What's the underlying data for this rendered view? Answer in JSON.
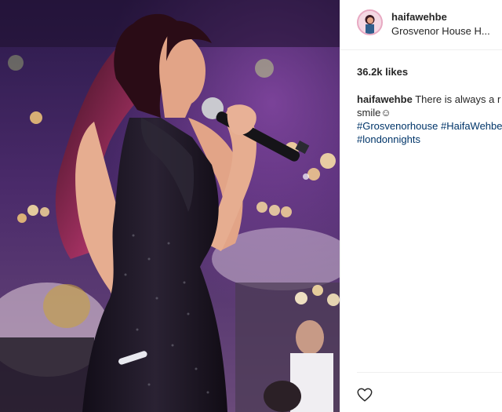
{
  "post": {
    "username": "haifawehbe",
    "location": "Grosvenor House H...",
    "likes": "36.2k likes",
    "caption": {
      "username": "haifawehbe",
      "text": "There is always a r",
      "line2": "smile☺",
      "hashtag_1": "#Grosvenorhouse",
      "hashtag_2": "#HaifaWehbe",
      "hashtag_3": "#londonnights"
    }
  },
  "icons": {
    "like": "heart-outline-icon",
    "avatar": "profile-avatar"
  },
  "colors": {
    "text": "#262626",
    "hashtag": "#003569",
    "border": "#efefef",
    "photo_bg": "#2a1340"
  }
}
